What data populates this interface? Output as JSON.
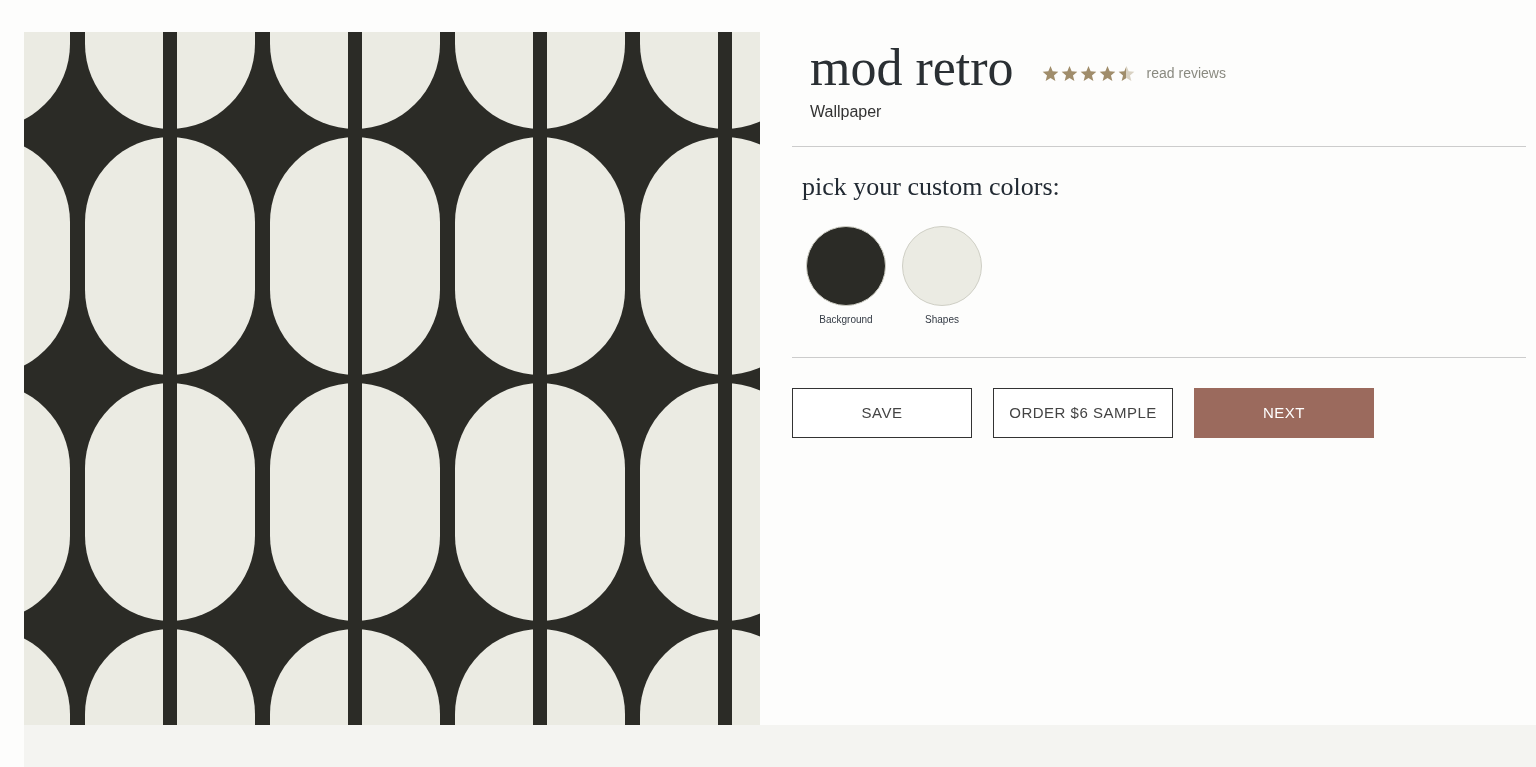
{
  "product": {
    "title": "mod retro",
    "stars": 4.5,
    "reviews_link": "read reviews",
    "type": "Wallpaper",
    "image": {
      "kind": "pattern"
    }
  },
  "colors": {
    "heading": "pick your custom colors:",
    "swatches": [
      {
        "label": "Background",
        "color": "#2b2b26"
      },
      {
        "label": "Shapes",
        "color": "#ebebe3"
      }
    ]
  },
  "buttons": [
    {
      "label": "SAVE",
      "kind": "outline"
    },
    {
      "label": "ORDER $6 SAMPLE",
      "kind": "outline"
    },
    {
      "label": "NEXT",
      "kind": "primary"
    }
  ]
}
